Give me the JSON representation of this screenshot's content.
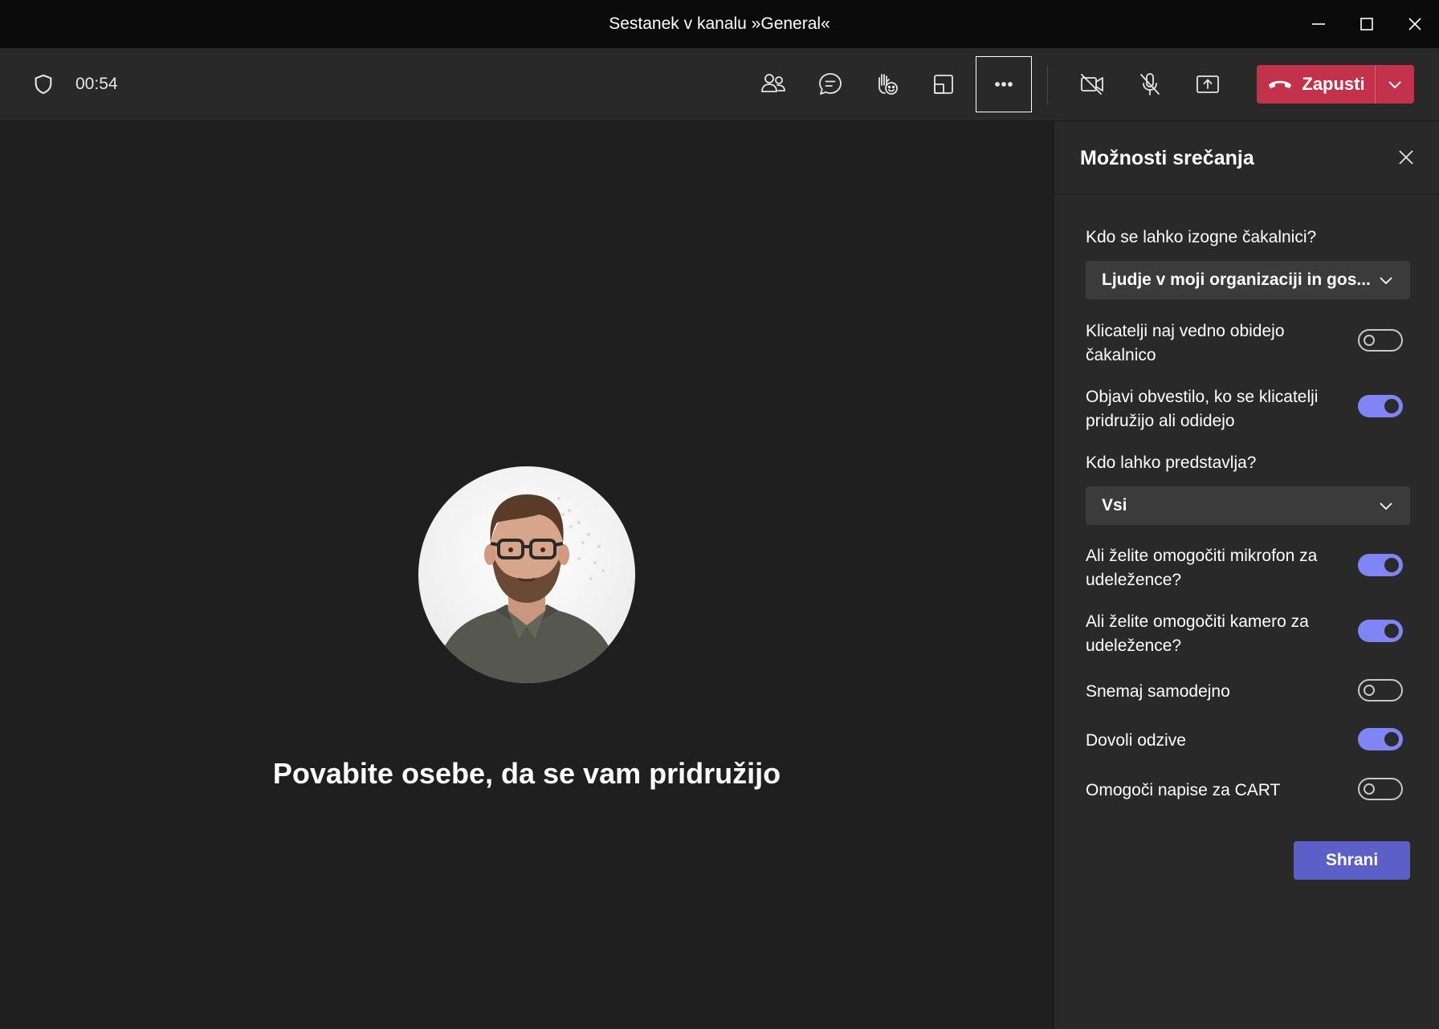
{
  "window": {
    "title": "Sestanek v kanalu »General«"
  },
  "toolbar": {
    "timer": "00:54",
    "leave_label": "Zapusti"
  },
  "stage": {
    "invite_text": "Povabite osebe, da se vam pridružijo"
  },
  "panel": {
    "title": "Možnosti srečanja",
    "save_label": "Shrani",
    "lobby_question": "Kdo se lahko izogne čakalnici?",
    "lobby_value": "Ljudje v moji organizaciji in gos...",
    "presenter_question": "Kdo lahko predstavlja?",
    "presenter_value": "Vsi",
    "options": [
      {
        "label": "Klicatelji naj vedno obidejo čakalnico",
        "on": false
      },
      {
        "label": "Objavi obvestilo, ko se klicatelji pridružijo ali odidejo",
        "on": true
      },
      {
        "label": "Ali želite omogočiti mikrofon za udeležence?",
        "on": true
      },
      {
        "label": "Ali želite omogočiti kamero za udeležence?",
        "on": true
      },
      {
        "label": "Snemaj samodejno",
        "on": false
      },
      {
        "label": "Dovoli odzive",
        "on": true
      },
      {
        "label": "Omogoči napise za CART",
        "on": false
      }
    ]
  },
  "colors": {
    "accent": "#7f85f5",
    "save_button": "#5b5fc7",
    "leave_button": "#c4314b"
  }
}
